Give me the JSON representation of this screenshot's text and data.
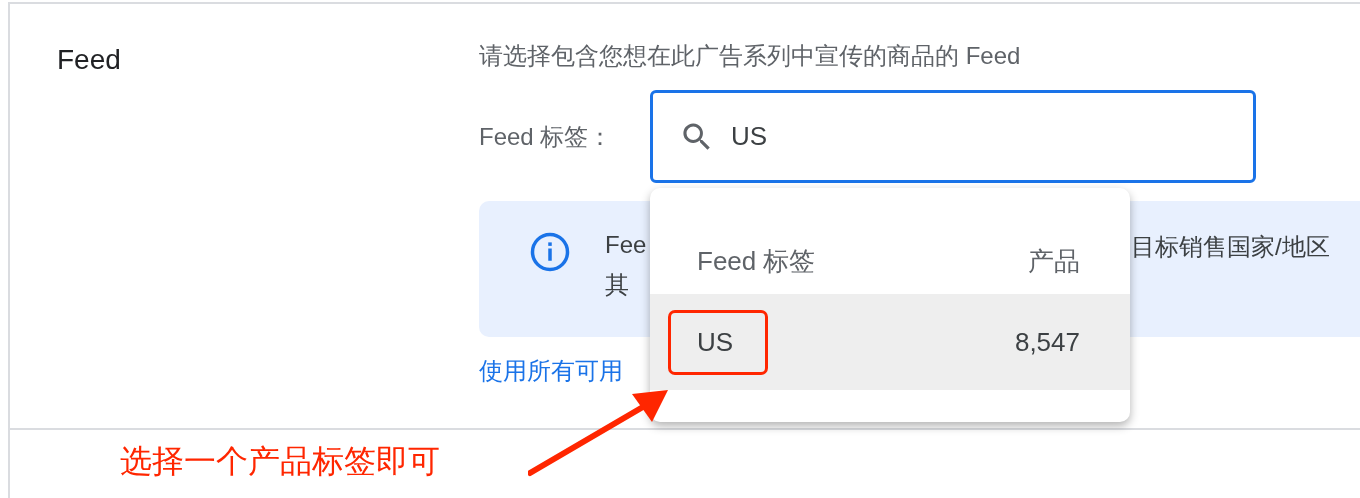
{
  "section": {
    "title": "Feed"
  },
  "description": "请选择包含您想在此广告系列中宣传的商品的 Feed",
  "field": {
    "label": "Feed 标签：",
    "value": "US"
  },
  "info": {
    "line_1_left": "Fee",
    "line_1_right": "目标销售国家/地区",
    "line_2_left": "其"
  },
  "link": "使用所有可用",
  "dropdown": {
    "columns": [
      "Feed 标签",
      "产品"
    ],
    "rows": [
      {
        "label": "US",
        "count": "8,547",
        "selected": true,
        "circled": true
      }
    ]
  },
  "annotation": {
    "text": "选择一个产品标签即可"
  }
}
